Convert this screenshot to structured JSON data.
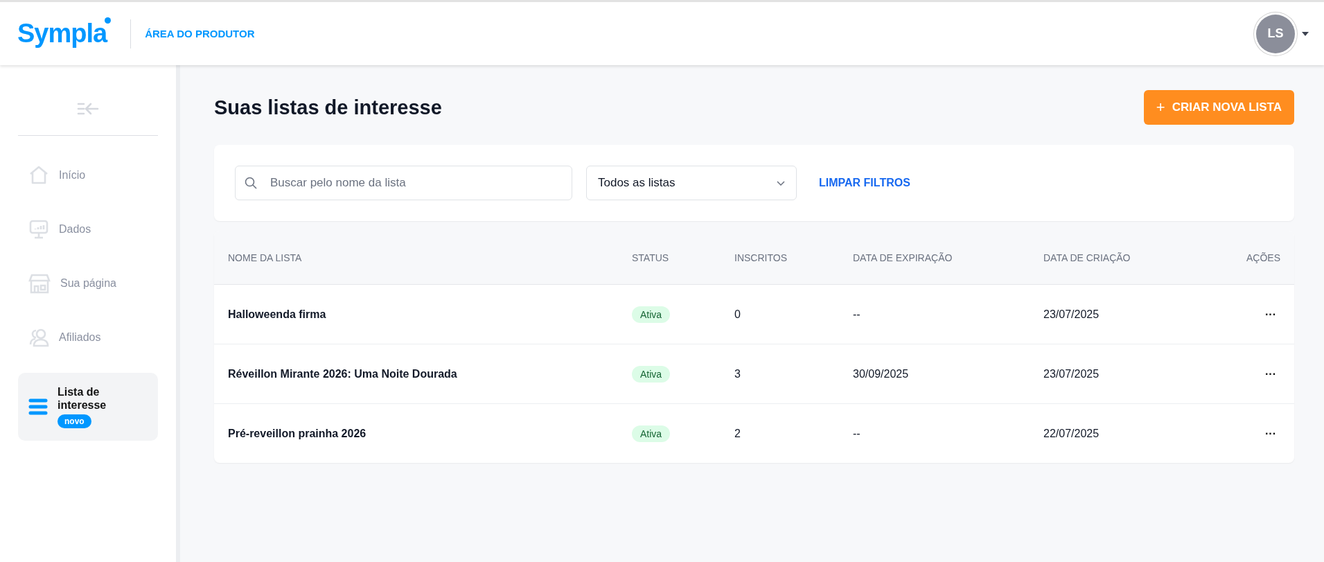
{
  "header": {
    "logo": "Sympla",
    "area": "ÁREA DO PRODUTOR",
    "avatar": "LS"
  },
  "sidebar": {
    "items": [
      {
        "label": "Início",
        "selected": false
      },
      {
        "label": "Dados",
        "selected": false
      },
      {
        "label": "Sua página",
        "selected": false
      },
      {
        "label": "Afiliados",
        "selected": false
      },
      {
        "label": "Lista de interesse",
        "selected": true,
        "badge": "novo"
      }
    ]
  },
  "page": {
    "title": "Suas listas de interesse",
    "create_button": "CRIAR NOVA LISTA",
    "create_icon": "+"
  },
  "filters": {
    "search": {
      "placeholder": "Buscar pelo nome da lista"
    },
    "select": {
      "value": "Todos as listas"
    },
    "clear": "LIMPAR FILTROS"
  },
  "table": {
    "columns": [
      "NOME DA LISTA",
      "STATUS",
      "INSCRITOS",
      "DATA DE EXPIRAÇÃO",
      "DATA DE CRIAÇÃO",
      "AÇÕES"
    ],
    "rows": [
      {
        "name": "Halloweenda firma",
        "status": "Ativa",
        "subscribers": "0",
        "expiration": "--",
        "created": "23/07/2025",
        "actions": "···"
      },
      {
        "name": "Réveillon Mirante 2026: Uma Noite Dourada",
        "status": "Ativa",
        "subscribers": "3",
        "expiration": "30/09/2025",
        "created": "23/07/2025",
        "actions": "···"
      },
      {
        "name": "Pré-reveillon prainha 2026",
        "status": "Ativa",
        "subscribers": "2",
        "expiration": "--",
        "created": "22/07/2025",
        "actions": "···"
      }
    ]
  }
}
